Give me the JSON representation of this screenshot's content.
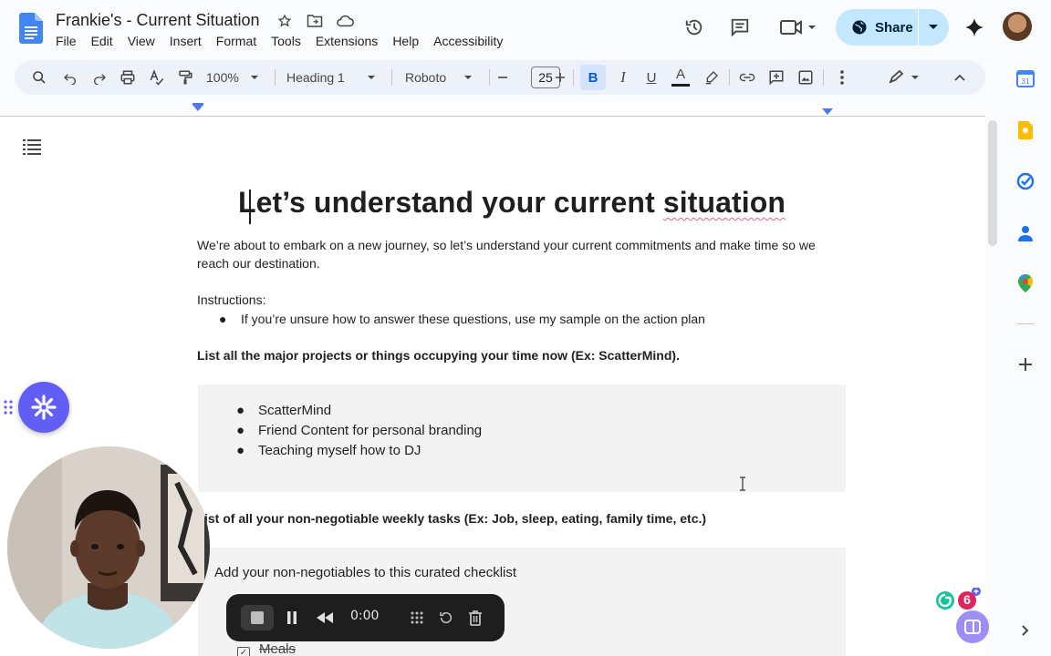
{
  "header": {
    "doc_title": "Frankie's - Current Situation",
    "menu": [
      "File",
      "Edit",
      "View",
      "Insert",
      "Format",
      "Tools",
      "Extensions",
      "Help",
      "Accessibility"
    ],
    "share_label": "Share"
  },
  "toolbar": {
    "zoom": "100%",
    "style": "Heading 1",
    "font": "Roboto",
    "font_size": "25",
    "bold_label": "B",
    "italic_label": "I",
    "underline_label": "U",
    "text_color_label": "A"
  },
  "document": {
    "heading_part1": "Let’s understand your current ",
    "heading_part2": "situation",
    "intro": "We’re about to embark on a new journey, so let’s understand your current commitments and make time so we reach our destination.",
    "instructions_label": "Instructions:",
    "instruction_bullet": "If you’re unsure how to answer these questions, use my sample on the action plan",
    "question1": "List all the major projects or things occupying your time now (Ex: ScatterMind).",
    "projects": [
      "ScatterMind",
      "Friend Content for personal branding",
      "Teaching myself how to DJ"
    ],
    "question2": "ist of all your non-negotiable weekly tasks (Ex: Job, sleep, eating, family time, etc.)",
    "checklist_title": "Add your non-negotiables to this curated checklist",
    "checklist_items": [
      {
        "label": "Meals",
        "checked": true
      }
    ]
  },
  "recorder": {
    "time": "0:00"
  },
  "grammarly": {
    "count": "6"
  },
  "colors": {
    "share_bg": "#c2e7ff",
    "toolbar_bg": "#edf2fa",
    "loom_purple": "#625df5",
    "accent_blue": "#0b57d0"
  }
}
